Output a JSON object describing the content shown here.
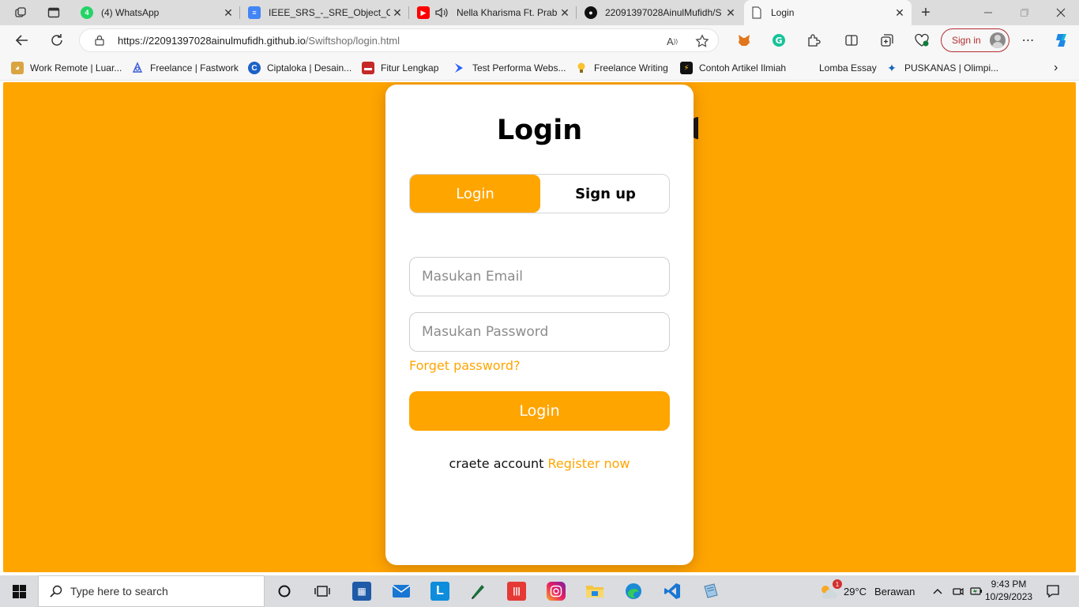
{
  "browser": {
    "tabs": [
      {
        "title": "(4) WhatsApp",
        "favicon": "whatsapp-icon",
        "color": "#25d366"
      },
      {
        "title": "IEEE_SRS_-_SRE_Object_Orie",
        "favicon": "google-docs-icon",
        "color": "#4285f4"
      },
      {
        "title": "Nella Kharisma Ft. Prab",
        "favicon": "youtube-icon",
        "color": "#ff0000"
      },
      {
        "title": "22091397028AinulMufidh/S",
        "favicon": "github-icon",
        "color": "#111111"
      },
      {
        "title": "Login",
        "favicon": "page-icon",
        "color": "#555555"
      }
    ],
    "url": {
      "host": "https://22091397028ainulmufidh.github.io",
      "path": "/Swiftshop/login.html"
    },
    "signin_label": "Sign in",
    "bookmarks": [
      {
        "label": "Work Remote | Luar...",
        "icon": "doge-icon"
      },
      {
        "label": "Freelance | Fastwork",
        "icon": "fastwork-icon"
      },
      {
        "label": "Ciptaloka | Desain...",
        "icon": "ciptaloka-icon"
      },
      {
        "label": "Fitur Lengkap",
        "icon": "toolbox-icon"
      },
      {
        "label": "Test Performa Webs...",
        "icon": "performance-icon"
      },
      {
        "label": "Freelance Writing",
        "icon": "bulb-icon"
      },
      {
        "label": "Contoh Artikel Ilmiah",
        "icon": "article-icon"
      },
      {
        "label": "Lomba Essay",
        "icon": "none"
      },
      {
        "label": "PUSKANAS | Olimpi...",
        "icon": "star-icon"
      }
    ]
  },
  "page": {
    "title": "Login",
    "tabs": {
      "login": "Login",
      "signup": "Sign up"
    },
    "email_placeholder": "Masukan Email",
    "password_placeholder": "Masukan Password",
    "forget_label": "Forget password?",
    "submit_label": "Login",
    "register_prefix": "craete account",
    "register_link": "Register now",
    "accent_color": "#ffa500"
  },
  "taskbar": {
    "search_placeholder": "Type here to search",
    "weather_temp": "29°C",
    "weather_desc": "Berawan",
    "weather_badge": "1",
    "time": "9:43 PM",
    "date": "10/29/2023"
  }
}
